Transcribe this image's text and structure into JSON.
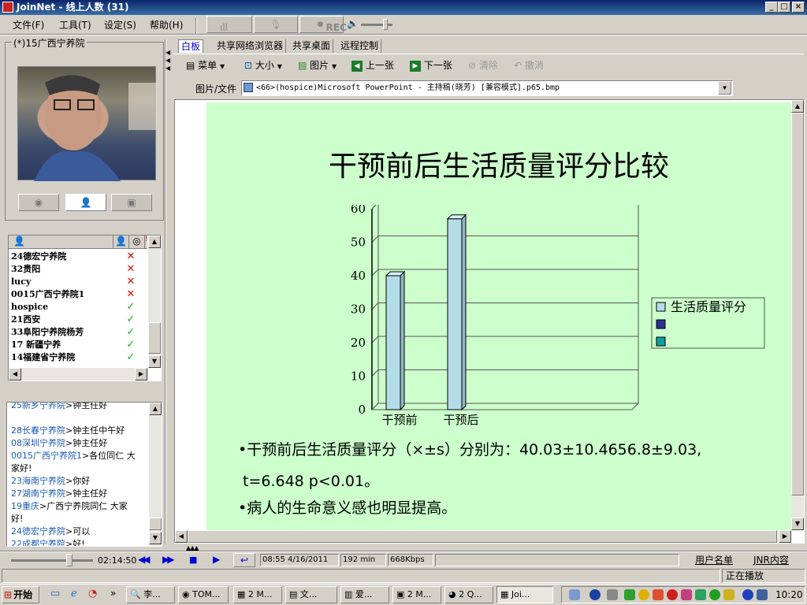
{
  "window": {
    "title": "JoinNet - 线上人数 (31)"
  },
  "menu": [
    "文件(F)",
    "工具(T)",
    "设定(S)",
    "帮助(H)"
  ],
  "media_controls": {
    "rec": "REC"
  },
  "webcam": {
    "label": "(*)15广西宁养院"
  },
  "users": [
    {
      "name": "24德宏宁养院",
      "status": "x"
    },
    {
      "name": "32贵阳",
      "status": "x"
    },
    {
      "name": "lucy",
      "status": "x"
    },
    {
      "name": "0015广西宁养院1",
      "status": "x"
    },
    {
      "name": "hospice",
      "status": "check"
    },
    {
      "name": "21西安",
      "status": "check"
    },
    {
      "name": "33阜阳宁养院杨芳",
      "status": "check"
    },
    {
      "name": "17 新疆宁养",
      "status": "check"
    },
    {
      "name": "14福建省宁养院",
      "status": "check"
    }
  ],
  "chat": [
    {
      "from": "25新乡宁养院",
      "text": ">钟主任好"
    },
    {
      "from": "",
      "text": ""
    },
    {
      "from": "28长春宁养院",
      "text": ">钟主任中午好"
    },
    {
      "from": "08深圳宁养院",
      "text": ">钟主任好"
    },
    {
      "from": "0015广西宁养院1",
      "text": ">各位同仁 大"
    },
    {
      "from": "",
      "text": "家好!"
    },
    {
      "from": "23海南宁养院",
      "text": ">你好"
    },
    {
      "from": "27湖南宁养院",
      "text": ">钟主任好"
    },
    {
      "from": "19重庆",
      "text": ">广西宁养院同仁 大家"
    },
    {
      "from": "",
      "text": "好!"
    },
    {
      "from": "24德宏宁养院",
      "text": ">可以"
    },
    {
      "from": "22成都宁养院",
      "text": ">好!"
    }
  ],
  "tabs": [
    "白板",
    "共享网络浏览器",
    "共享桌面",
    "远程控制"
  ],
  "toolbar": {
    "menu": "菜单",
    "size": "大小",
    "picture": "图片",
    "prev": "上一张",
    "next": "下一张",
    "clear": "清除",
    "undo": "撤消"
  },
  "file": {
    "label": "图片/文件",
    "value": "<66>(hospice)Microsoft PowerPoint - 主持稿(晓芳) [兼容模式].p65.bmp"
  },
  "slide": {
    "title": "干预前后生活质量评分比较",
    "bullet1": "•干预前后生活质量评分（×±s）分别为：40.03±10.4656.8±9.03,",
    "bullet1b": "t=6.648  p<0.01。",
    "bullet2": "•病人的生命意义感也明显提高。"
  },
  "chart_data": {
    "type": "bar",
    "categories": [
      "干预前",
      "干预后"
    ],
    "series": [
      {
        "name": "生活质量评分",
        "values": [
          40,
          57
        ]
      }
    ],
    "legend": [
      "生活质量评分",
      "",
      ""
    ],
    "legend_colors": [
      "#b4dce8",
      "#2e3192",
      "#0e9f9a"
    ],
    "ylim": [
      0,
      60
    ],
    "yticks": [
      0,
      10,
      20,
      30,
      40,
      50,
      60
    ],
    "grid": true,
    "legend_position": "right"
  },
  "playback": {
    "time": "02:14:50",
    "datetime": "08:55 4/16/2011",
    "duration": "192 min",
    "bitrate": "668Kbps",
    "user_list": "用户名单",
    "jnr": "JNR内容",
    "status": "正在播放"
  },
  "taskbar": {
    "start": "开始",
    "buttons": [
      "李...",
      "TOM...",
      "2 M...",
      "文...",
      "爱...",
      "2 M...",
      "2 Q...",
      "Joi..."
    ],
    "clock": "10:20"
  },
  "colors": {
    "slide_bg": "#ccffcc",
    "title_bar": "#0a246a",
    "bar_fill": "#b4dce8"
  }
}
